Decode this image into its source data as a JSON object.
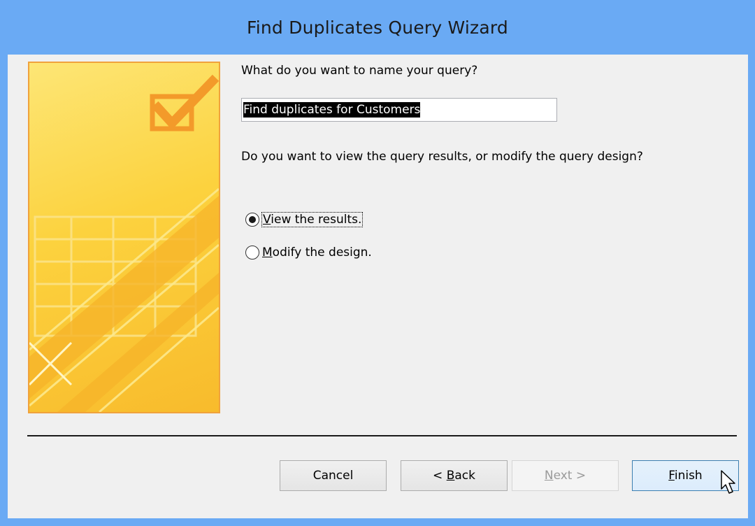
{
  "window": {
    "title": "Find Duplicates Query Wizard"
  },
  "prompts": {
    "name_question": "What do you want to name your query?",
    "view_question": "Do you want to view the query results, or modify the query design?"
  },
  "query_name": {
    "value": "Find duplicates for Customers"
  },
  "options": [
    {
      "mnemonic": "V",
      "rest": "iew the results.",
      "checked": true
    },
    {
      "mnemonic": "M",
      "rest": "odify the design.",
      "checked": false
    }
  ],
  "buttons": {
    "cancel": {
      "label": "Cancel"
    },
    "back": {
      "prefix": "< ",
      "mnemonic": "B",
      "rest": "ack"
    },
    "next": {
      "mnemonic": "N",
      "rest": "ext >",
      "enabled": false
    },
    "finish": {
      "mnemonic": "F",
      "rest": "inish"
    }
  },
  "colors": {
    "titlebar": "#6aaaf4",
    "client_bg": "#f0f0f0",
    "illustration_border": "#f0a23c",
    "checkmark": "#f39a2a"
  },
  "icons": {
    "illustration": "checklist-table-illustration",
    "cursor": "arrow-cursor-icon"
  }
}
